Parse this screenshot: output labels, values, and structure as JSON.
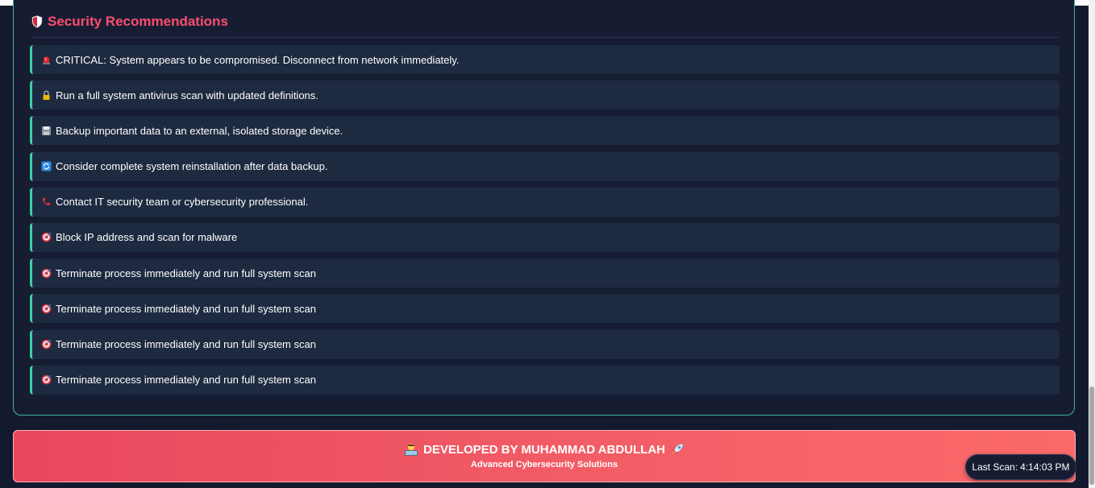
{
  "panel": {
    "title": "Security Recommendations",
    "title_icon": "shield-icon",
    "accent": "#3fcfa5",
    "title_color": "#ff4d6d"
  },
  "recommendations": [
    {
      "icon": "siren-icon",
      "text": "CRITICAL: System appears to be compromised. Disconnect from network immediately."
    },
    {
      "icon": "lock-icon",
      "text": "Run a full system antivirus scan with updated definitions."
    },
    {
      "icon": "floppy-disk-icon",
      "text": "Backup important data to an external, isolated storage device."
    },
    {
      "icon": "refresh-icon",
      "text": "Consider complete system reinstallation after data backup."
    },
    {
      "icon": "phone-icon",
      "text": "Contact IT security team or cybersecurity professional."
    },
    {
      "icon": "target-icon",
      "text": "Block IP address and scan for malware"
    },
    {
      "icon": "target-icon",
      "text": "Terminate process immediately and run full system scan"
    },
    {
      "icon": "target-icon",
      "text": "Terminate process immediately and run full system scan"
    },
    {
      "icon": "target-icon",
      "text": "Terminate process immediately and run full system scan"
    },
    {
      "icon": "target-icon",
      "text": "Terminate process immediately and run full system scan"
    }
  ],
  "footer": {
    "title": "DEVELOPED BY MUHAMMAD ABDULLAH",
    "subtitle": "Advanced Cybersecurity Solutions",
    "left_icon": "technologist-icon",
    "right_icon": "rocket-icon"
  },
  "last_scan": {
    "label": "Last Scan:",
    "time": "4:14:03 PM"
  }
}
